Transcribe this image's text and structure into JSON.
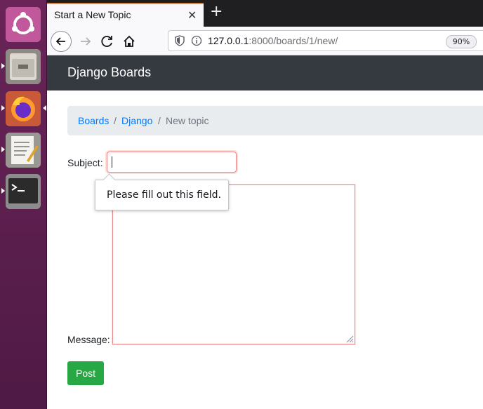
{
  "browser": {
    "tab_title": "Start a New Topic",
    "url_host": "127.0.0.1",
    "url_rest": ":8000/boards/1/new/",
    "zoom": "90%"
  },
  "site": {
    "brand": "Django Boards"
  },
  "breadcrumb": {
    "items": [
      "Boards",
      "Django",
      "New topic"
    ],
    "separator": "/"
  },
  "form": {
    "subject_label": "Subject:",
    "subject_value": "",
    "message_label": "Message:",
    "message_value": "",
    "validation_message": "Please fill out this field.",
    "submit_label": "Post"
  },
  "colors": {
    "launcher": "#5b1e4a",
    "navbar": "#343a40",
    "link": "#007bff",
    "post_button": "#28a745",
    "invalid_border": "#e88a8a"
  }
}
